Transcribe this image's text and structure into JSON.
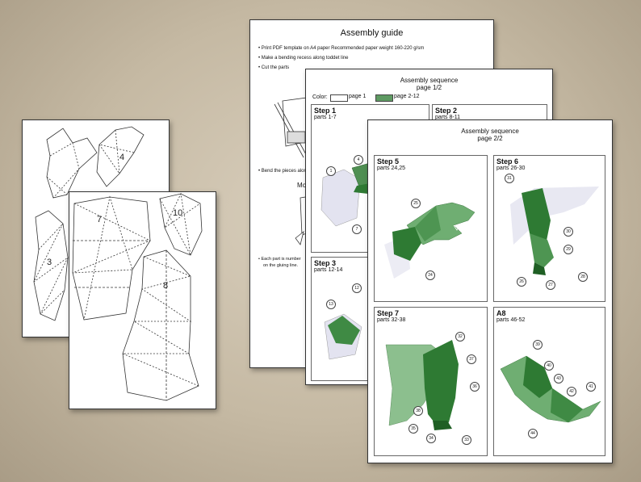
{
  "templates": {
    "sheet_a_numbers": [
      "4",
      "3"
    ],
    "sheet_b_numbers": [
      "7",
      "10",
      "8"
    ]
  },
  "guide": {
    "title": "Assembly guide",
    "bullets": [
      "Print PDF template on A4 paper Recommended paper weight 160-220 g/sm",
      "Make a bending recess along toddet line",
      "Cut the parts"
    ],
    "bend_text": "Bend the pieces alon",
    "mo_text": "Mo",
    "footnote_1": "Each part is number",
    "footnote_2": "on the gluing line."
  },
  "seq1": {
    "title": "Assembly sequence",
    "subtitle": "page 1/2",
    "color_label": "Color:",
    "legend_page1": "page 1",
    "legend_page2": "page 2-12",
    "colors": {
      "page1": "#ffffff",
      "page2": "#5e9a62"
    },
    "steps": [
      {
        "title": "Step 1",
        "parts": "parts 1-7",
        "callouts": [
          "1",
          "4",
          "7"
        ]
      },
      {
        "title": "Step 2",
        "parts": "parts 8-11"
      },
      {
        "title": "Step 3",
        "parts": "parts 12-14",
        "callouts": [
          "13",
          "12"
        ]
      }
    ]
  },
  "seq2": {
    "title": "Assembly sequence",
    "subtitle": "page 2/2",
    "steps": [
      {
        "title": "Step 5",
        "parts": "parts 24,25",
        "callouts": [
          "25",
          "24"
        ]
      },
      {
        "title": "Step 6",
        "parts": "parts 26-30",
        "callouts": [
          "31",
          "30",
          "29",
          "26",
          "27",
          "28"
        ]
      },
      {
        "title": "Step 7",
        "parts": "parts 32-38",
        "callouts": [
          "32",
          "37",
          "36",
          "38",
          "35",
          "34",
          "33"
        ]
      },
      {
        "title": "A8",
        "parts": "parts 46-52",
        "callouts": [
          "39",
          "40",
          "43",
          "42",
          "41",
          "44"
        ]
      }
    ]
  }
}
